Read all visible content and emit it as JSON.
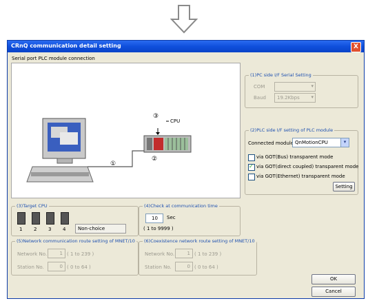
{
  "window": {
    "title": "CRnQ communication detail setting",
    "close_glyph": "X"
  },
  "connection_type": "Serial port PLC module connection",
  "diagram": {
    "cpu_label": "CPU",
    "marker1": "①",
    "marker2": "②",
    "marker3": "③"
  },
  "pc_side": {
    "legend": "(1)PC side I/F Serial Setting",
    "com_label": "COM",
    "com_value": "",
    "baud_label": "Baud",
    "baud_value": "19.2Kbps"
  },
  "plc_side": {
    "legend": "(2)PLC side I/F setting of PLC module",
    "connected_module_label": "Connected module",
    "connected_module_value": "QnMotionCPU",
    "options": [
      {
        "label": "via GOT(Bus) transparent mode",
        "checked": false
      },
      {
        "label": "via GOT(direct coupled) transparent mode",
        "checked": true
      },
      {
        "label": "via GOT(Ethernet) transparent mode",
        "checked": false
      }
    ],
    "setting_button": "Setting"
  },
  "target_cpu": {
    "legend": "(3)Target CPU",
    "cpus": [
      "1",
      "2",
      "3",
      "4"
    ],
    "non_choice": "Non-choice"
  },
  "check_time": {
    "legend": "(4)Check at communication time",
    "value": "10",
    "unit": "Sec",
    "range": "( 1 to 9999 )"
  },
  "mnet_route": {
    "legend": "(5)Network communication route setting of MNET/10",
    "network_label": "Network No.",
    "network_value": "1",
    "network_range": "( 1 to 239 )",
    "station_label": "Station No.",
    "station_value": "0",
    "station_range": "( 0 to 64 )"
  },
  "coexist_route": {
    "legend": "(6)Coexistence network route setting of MNET/10",
    "network_label": "Network No.",
    "network_value": "1",
    "network_range": "( 1 to 239 )",
    "station_label": "Station No.",
    "station_value": "0",
    "station_range": "( 0 to 64 )"
  },
  "buttons": {
    "ok": "OK",
    "cancel": "Cancel"
  },
  "colors": {
    "title_bar": "#0f4fdc",
    "dialog_bg": "#ece9d8",
    "legend_text": "#1c4fb0"
  }
}
